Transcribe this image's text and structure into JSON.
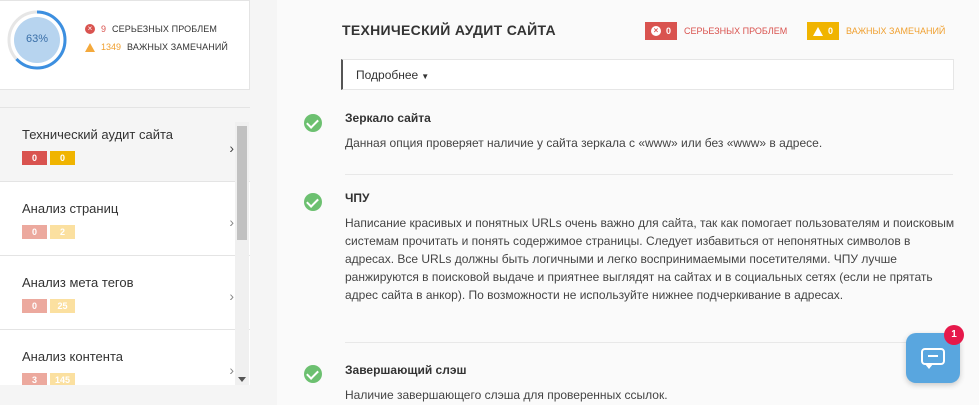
{
  "summary": {
    "score_label": "63%",
    "score_fraction": 0.63,
    "serious_count": "9",
    "serious_label": "СЕРЬЕЗНЫХ ПРОБЛЕМ",
    "warnings_count": "1349",
    "warnings_label": "ВАЖНЫХ ЗАМЕЧАНИЙ"
  },
  "sidebar": {
    "items": [
      {
        "title": "Технический аудит сайта",
        "errors": "0",
        "warnings": "0",
        "active": true
      },
      {
        "title": "Анализ страниц",
        "errors": "0",
        "warnings": "2",
        "active": false
      },
      {
        "title": "Анализ мета тегов",
        "errors": "0",
        "warnings": "25",
        "active": false
      },
      {
        "title": "Анализ контента",
        "errors": "3",
        "warnings": "145",
        "active": false
      }
    ]
  },
  "main": {
    "title": "ТЕХНИЧЕСКИЙ АУДИТ САЙТА",
    "errors_count": "0",
    "errors_label": "СЕРЬЕЗНЫХ ПРОБЛЕМ",
    "warnings_count": "0",
    "warnings_label": "ВАЖНЫХ ЗАМЕЧАНИЙ",
    "details_label": "Подробнее",
    "sections": [
      {
        "title": "Зеркало сайта",
        "text": "Данная опция проверяет наличие у сайта зеркала с «www» или без «www» в адресе."
      },
      {
        "title": "ЧПУ",
        "text": "Написание красивых и понятных URLs очень важно для сайта, так как помогает пользователям и поисковым системам прочитать и понять содержимое страницы. Следует избавиться от непонятных символов в адресах. Все URLs должны быть логичными и легко воспринимаемыми посетителями. ЧПУ лучше ранжируются в поисковой выдаче и приятнее выглядят на сайтах и в социальных сетях (если не прятать адрес сайта в анкор). По возможности не используйте нижнее подчеркивание в адресах."
      },
      {
        "title": "Завершающий слэш",
        "text": "Наличие завершающего слэша для проверенных ссылок."
      }
    ]
  },
  "chat": {
    "badge_count": "1"
  },
  "colors": {
    "error": "#d9534f",
    "warning": "#f0b400",
    "success": "#6cc070",
    "chat": "#59a6df",
    "chat_badge": "#e6194b"
  }
}
